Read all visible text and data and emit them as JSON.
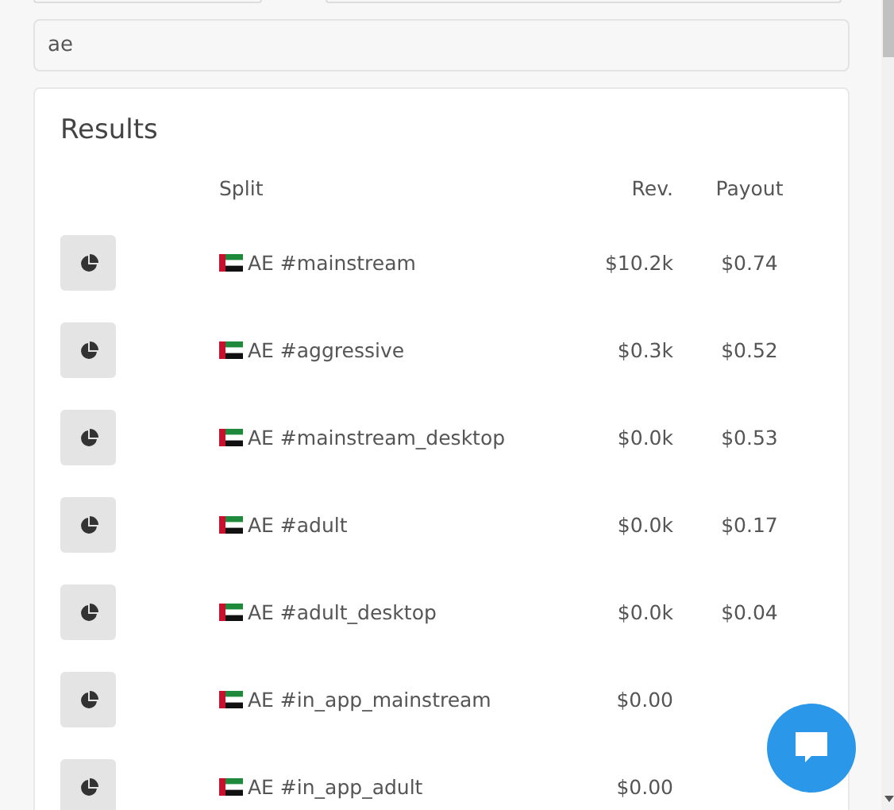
{
  "search": {
    "value": "ae"
  },
  "results": {
    "title": "Results",
    "columns": [
      "Split",
      "Rev.",
      "Payout"
    ],
    "rows": [
      {
        "split": "AE #mainstream",
        "rev": "$10.2k",
        "payout": "$0.74"
      },
      {
        "split": "AE #aggressive",
        "rev": "$0.3k",
        "payout": "$0.52"
      },
      {
        "split": "AE #mainstream_desktop",
        "rev": "$0.0k",
        "payout": "$0.53"
      },
      {
        "split": "AE #adult",
        "rev": "$0.0k",
        "payout": "$0.17"
      },
      {
        "split": "AE #adult_desktop",
        "rev": "$0.0k",
        "payout": "$0.04"
      },
      {
        "split": "AE #in_app_mainstream",
        "rev": "$0.00"
      },
      {
        "split": "AE #in_app_adult",
        "rev": "$0.00"
      }
    ]
  }
}
